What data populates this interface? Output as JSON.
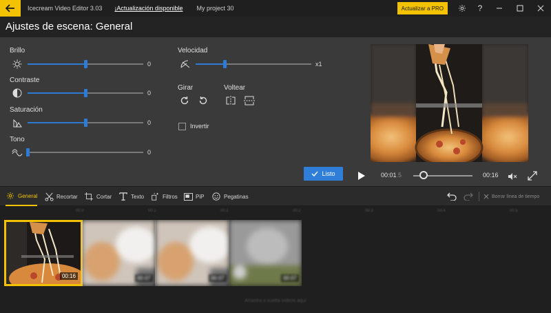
{
  "app": {
    "title": "Icecream Video Editor 3.03",
    "update_link": "¡Actualización disponible",
    "project": "My project 30",
    "pro_button": "Actualizar a PRO",
    "help": "?"
  },
  "header": {
    "title": "Ajustes de escena: General"
  },
  "settings": {
    "brightness": {
      "label": "Brillo",
      "value": "0",
      "level": 0.5,
      "icon": "sun-icon"
    },
    "contrast": {
      "label": "Contraste",
      "value": "0",
      "level": 0.5,
      "icon": "contrast-icon"
    },
    "saturation": {
      "label": "Saturación",
      "value": "0",
      "level": 0.5,
      "icon": "saturation-icon"
    },
    "hue": {
      "label": "Tono",
      "value": "0",
      "level": 0.0,
      "icon": "hue-icon"
    },
    "speed": {
      "label": "Velocidad",
      "value": "x1",
      "level": 0.25,
      "icon": "speed-icon"
    },
    "rotate": {
      "label": "Girar"
    },
    "flip": {
      "label": "Voltear"
    },
    "invert": {
      "label": "Invertir",
      "checked": false
    },
    "done_button": "Listo"
  },
  "preview": {
    "current_time": "00:01",
    "current_time_fraction": ".5",
    "duration": "00:16",
    "progress": 0.18
  },
  "toolbar": {
    "tools": [
      {
        "label": "General",
        "icon": "gear-icon",
        "active": true
      },
      {
        "label": "Recortar",
        "icon": "scissors-icon",
        "active": false
      },
      {
        "label": "Cortar",
        "icon": "crop-icon",
        "active": false
      },
      {
        "label": "Texto",
        "icon": "text-icon",
        "active": false
      },
      {
        "label": "Filtros",
        "icon": "filters-icon",
        "active": false
      },
      {
        "label": "PiP",
        "icon": "pip-icon",
        "active": false
      },
      {
        "label": "Pegatinas",
        "icon": "sticker-icon",
        "active": false
      }
    ],
    "clear_timeline": "Borrar línea de tiempo"
  },
  "timeline": {
    "ruler": [
      "00:0",
      "00:1",
      "00:1",
      "00:2",
      "00:3",
      "00:4",
      "00:5"
    ],
    "clips": [
      {
        "duration": "00:16",
        "selected": true
      },
      {
        "duration": "00:07",
        "selected": false
      },
      {
        "duration": "00:07",
        "selected": false
      },
      {
        "duration": "00:07",
        "selected": false
      }
    ],
    "hint": "Arrastra o suelta vídeos aquí"
  },
  "colors": {
    "accent": "#f3c200",
    "primary": "#2f7fd9"
  }
}
